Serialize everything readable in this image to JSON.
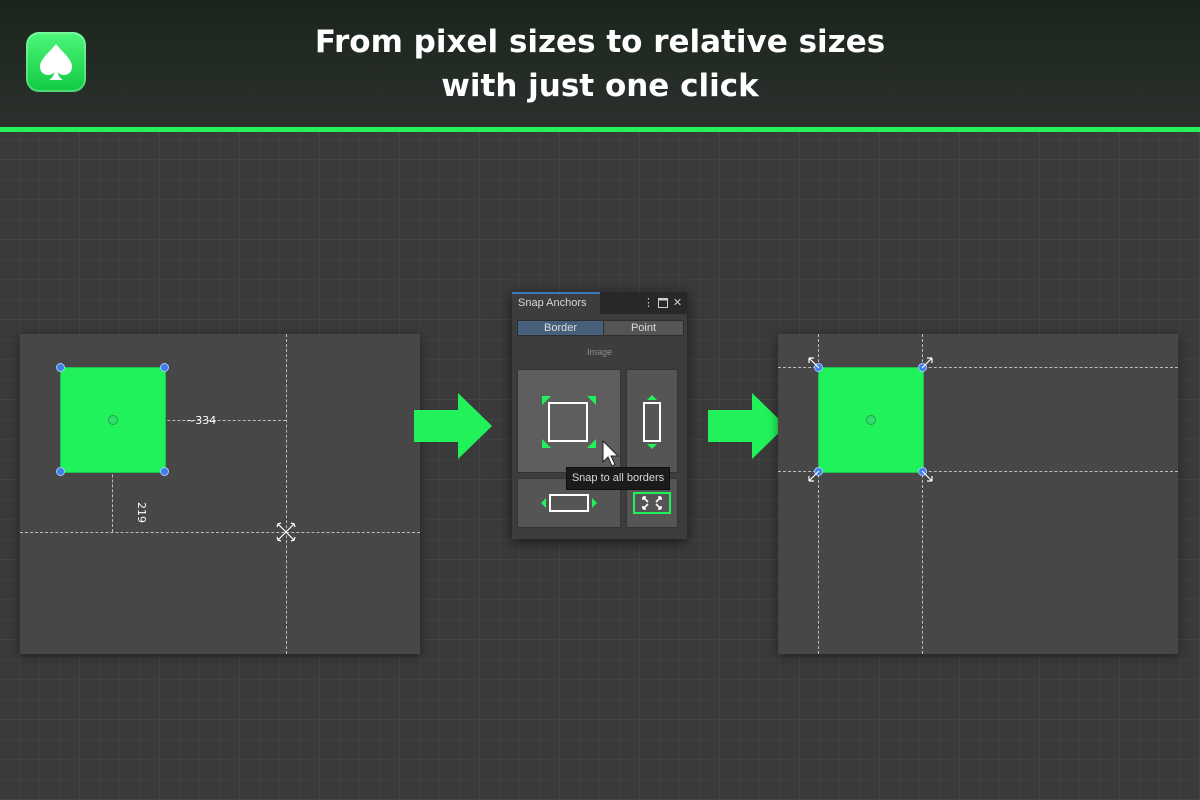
{
  "header": {
    "logo_icon": "spade-icon",
    "headline_line1": "From pixel sizes to relative sizes",
    "headline_line2": "with just one click",
    "accent_color": "#27f05a"
  },
  "before_canvas": {
    "offset_x_label": "~334",
    "offset_y_label": "219",
    "element_color": "#1ff25b",
    "handle_color": "#3d80e6"
  },
  "snap_panel": {
    "title": "Snap Anchors",
    "menu_icon": "kebab-icon",
    "maximize_icon": "maximize-icon",
    "close_icon": "close-icon",
    "tabs": [
      {
        "label": "Border",
        "selected": true
      },
      {
        "label": "Point",
        "selected": false
      }
    ],
    "section_label": "Image",
    "buttons": [
      {
        "icon": "snap-all-borders-icon"
      },
      {
        "icon": "snap-vertical-borders-icon"
      },
      {
        "icon": "snap-horizontal-borders-icon"
      },
      {
        "icon": "stretch-icon"
      }
    ],
    "tooltip": "Snap to all borders"
  },
  "arrows": {
    "color": "#22f25a",
    "icon": "right-arrow-icon"
  }
}
